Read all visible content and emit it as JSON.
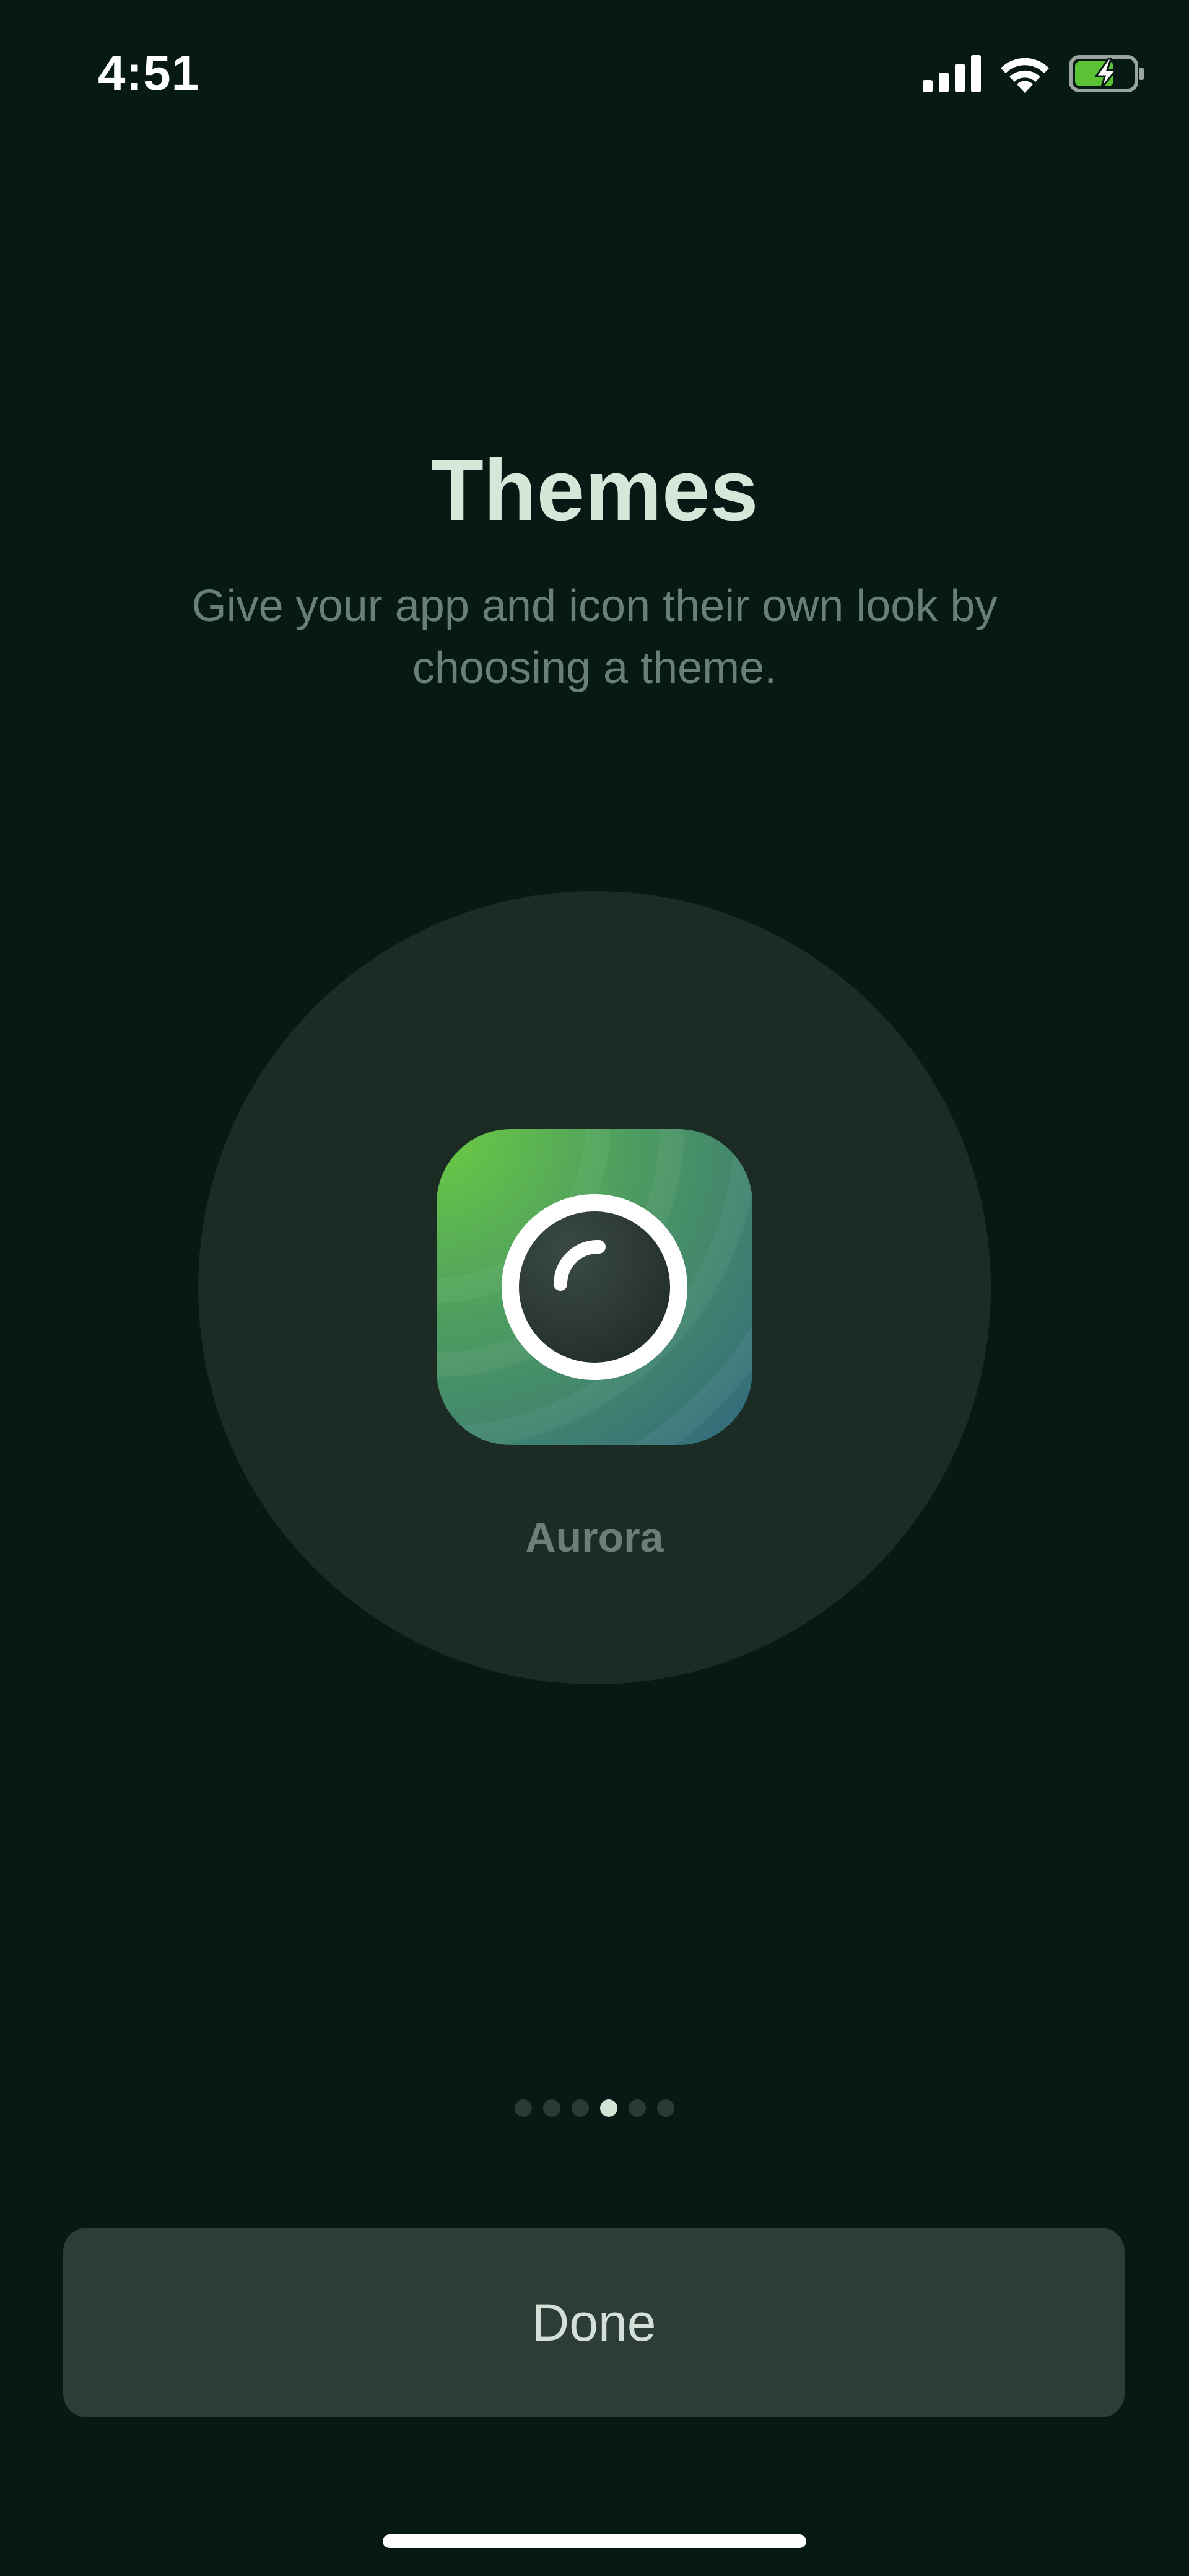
{
  "status_bar": {
    "time": "4:51",
    "icons": [
      "cellular-signal-icon",
      "wifi-icon",
      "battery-charging-icon"
    ]
  },
  "header": {
    "title": "Themes",
    "subtitle": "Give your app and icon their own look by choosing a theme."
  },
  "theme": {
    "name": "Aurora",
    "icon": "aurora-camera-app-icon"
  },
  "pager": {
    "total": 6,
    "active_index": 3
  },
  "footer": {
    "done_label": "Done"
  },
  "colors": {
    "background": "#071914",
    "circle": "#1c2c25",
    "title": "#d6e6d9",
    "subtitle": "#6a8076",
    "button": "#2d3c37",
    "dot_active": "#d3e3d6",
    "dot_inactive": "#2b3a34",
    "battery_green": "#5bc236"
  }
}
